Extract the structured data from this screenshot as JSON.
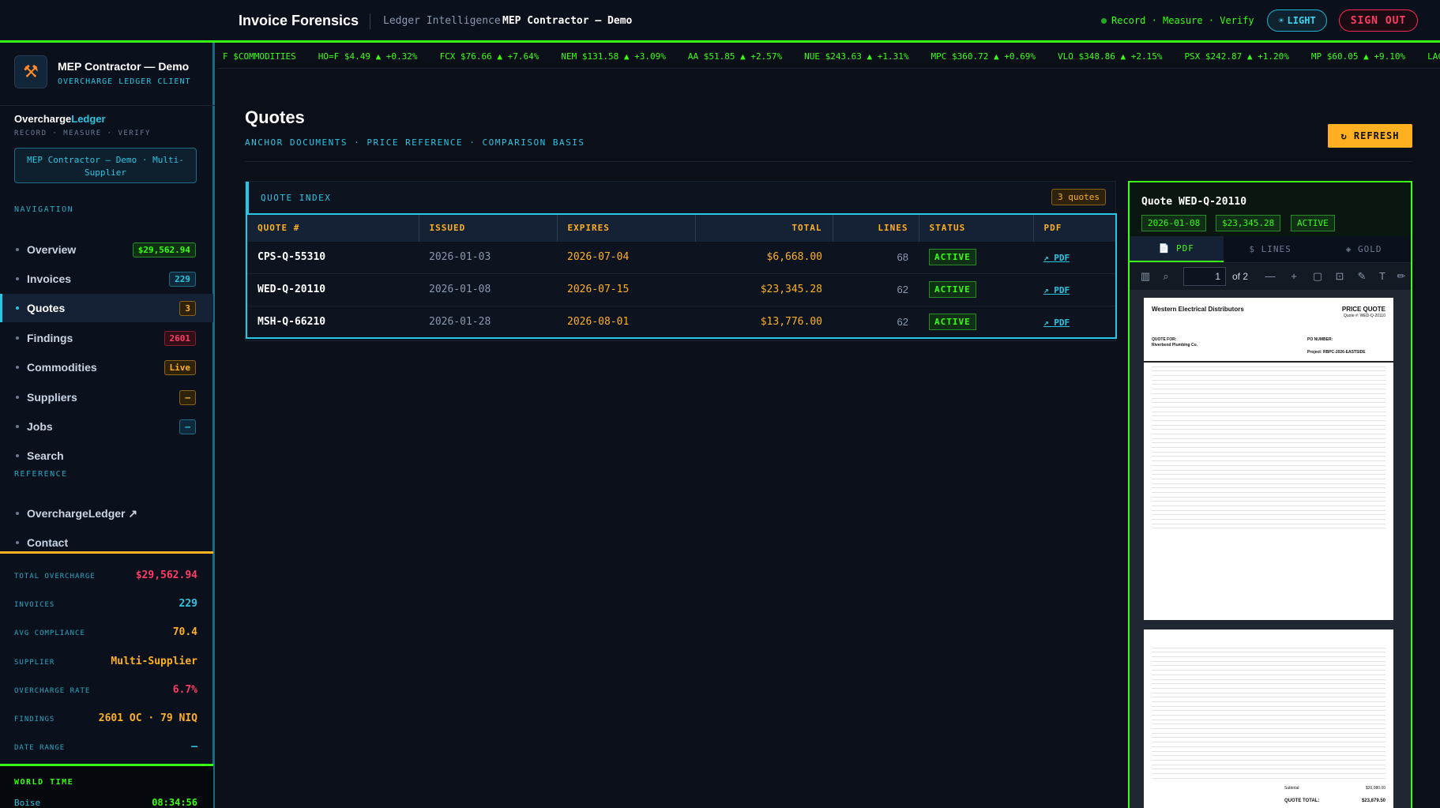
{
  "topbar": {
    "brand": "Invoice Forensics",
    "subtitle": "Ledger Intelligence",
    "client": "MEP Contractor — Demo",
    "status": "Record · Measure · Verify",
    "light_label": "LIGHT",
    "signout_label": "SIGN OUT"
  },
  "ticker": [
    "HO=F $4.49 ▲ +0.32%",
    "FCX $76.66 ▲ +7.64%",
    "NEM $131.58 ▲ +3.09%",
    "AA $51.85 ▲ +2.57%",
    "NUE $243.63 ▲ +1.31%",
    "MPC $360.72 ▲ +0.69%",
    "VLO $348.86 ▲ +2.15%",
    "PSX $242.87 ▲ +1.20%",
    "MP $60.05 ▲ +9.10%",
    "LAC $3.14 ▲ +"
  ],
  "ticker_lead": "F $COMMODITIES",
  "sidebar": {
    "client_name": "MEP Contractor — Demo",
    "client_type": "OVERCHARGE LEDGER CLIENT",
    "brand_a": "Overcharge",
    "brand_b": "Ledger",
    "brand_sub": "RECORD · MEASURE · VERIFY",
    "client_select": "MEP Contractor — Demo · Multi-Supplier",
    "nav_label": "NAVIGATION",
    "nav": [
      {
        "label": "Overview",
        "badge": "$29,562.94"
      },
      {
        "label": "Invoices",
        "badge": "229"
      },
      {
        "label": "Quotes",
        "badge": "3"
      },
      {
        "label": "Findings",
        "badge": "2601"
      },
      {
        "label": "Commodities",
        "badge": "Live"
      },
      {
        "label": "Suppliers",
        "badge": "—"
      },
      {
        "label": "Jobs",
        "badge": "—"
      },
      {
        "label": "Search",
        "badge": ""
      }
    ],
    "ref_label": "REFERENCE",
    "ref": [
      {
        "label": "OverchargeLedger ↗"
      },
      {
        "label": "Contact"
      }
    ],
    "stats": [
      {
        "k": "TOTAL OVERCHARGE",
        "v": "$29,562.94"
      },
      {
        "k": "INVOICES",
        "v": "229"
      },
      {
        "k": "AVG COMPLIANCE",
        "v": "70.4"
      },
      {
        "k": "SUPPLIER",
        "v": "Multi-Supplier"
      },
      {
        "k": "OVERCHARGE RATE",
        "v": "6.7%"
      },
      {
        "k": "FINDINGS",
        "v": "2601 OC · 79 NIQ"
      },
      {
        "k": "DATE RANGE",
        "v": "—"
      }
    ],
    "worldtime_label": "WORLD TIME",
    "worldtime_city": "Boise",
    "worldtime_value": "08:34:56"
  },
  "main": {
    "title": "Quotes",
    "subtitle": "ANCHOR DOCUMENTS · PRICE REFERENCE · COMPARISON BASIS",
    "refresh_label": "↻ REFRESH",
    "index_title": "QUOTE INDEX",
    "index_count": "3 quotes",
    "columns": [
      "QUOTE #",
      "ISSUED",
      "EXPIRES",
      "TOTAL",
      "LINES",
      "STATUS",
      "PDF"
    ],
    "rows": [
      {
        "quote": "CPS-Q-55310",
        "issued": "2026-01-03",
        "expires": "2026-07-04",
        "total": "$6,668.00",
        "lines": "68",
        "status": "ACTIVE",
        "pdf": "↗ PDF"
      },
      {
        "quote": "WED-Q-20110",
        "issued": "2026-01-08",
        "expires": "2026-07-15",
        "total": "$23,345.28",
        "lines": "62",
        "status": "ACTIVE",
        "pdf": "↗ PDF"
      },
      {
        "quote": "MSH-Q-66210",
        "issued": "2026-01-28",
        "expires": "2026-08-01",
        "total": "$13,776.00",
        "lines": "62",
        "status": "ACTIVE",
        "pdf": "↗ PDF"
      }
    ]
  },
  "viewer": {
    "title": "Quote WED-Q-20110",
    "date": "2026-01-08",
    "amount": "$23,345.28",
    "status": "ACTIVE",
    "tabs": [
      "📄 PDF",
      "$ LINES",
      "◈ GOLD"
    ],
    "page_value": "1",
    "page_of": "of 2",
    "doc": {
      "company": "Western Electrical Distributors",
      "doc_title": "PRICE QUOTE",
      "quote_line": "Quote #: WED-Q-20110",
      "quote_for": "QUOTE FOR:",
      "customer": "Riverbend Plumbing Co.",
      "po_label": "PO NUMBER:",
      "project": "Project: RBPC-2026-EASTSIDE",
      "subtotal_label": "Subtotal:",
      "subtotal": "$20,080.00",
      "total_label": "QUOTE TOTAL:",
      "total": "$23,879.50"
    }
  }
}
